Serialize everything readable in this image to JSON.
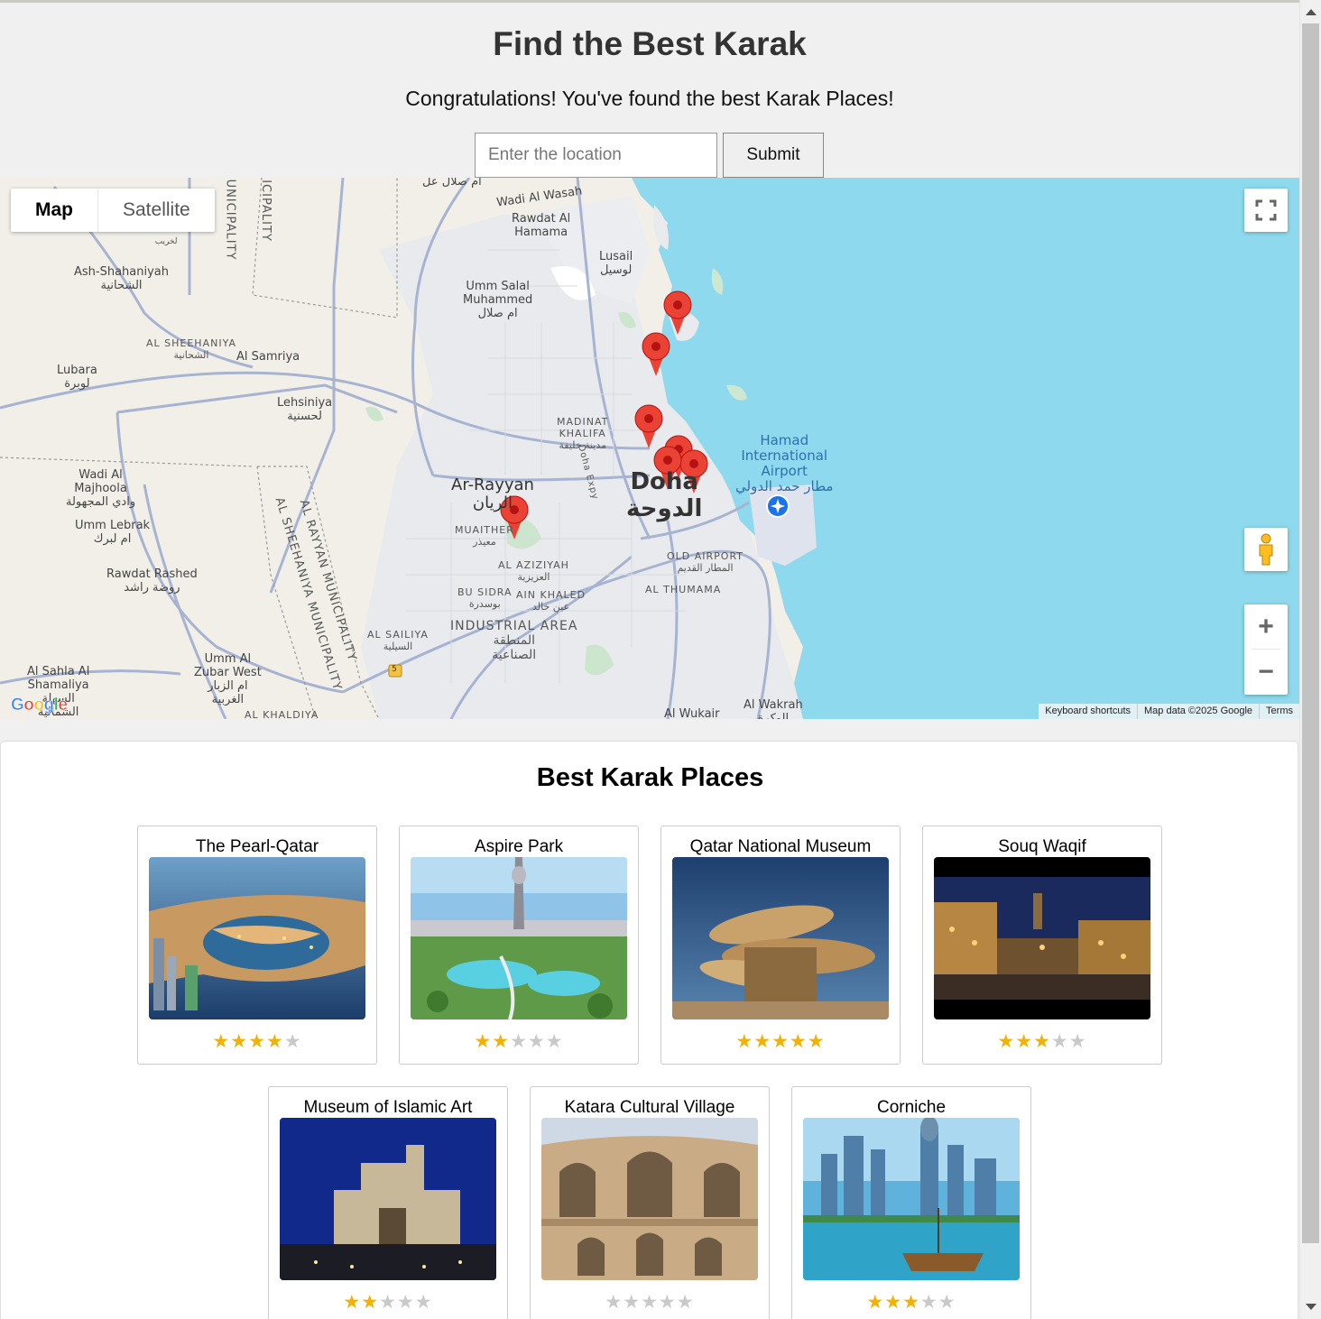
{
  "header": {
    "title": "Find the Best Karak",
    "subtitle": "Congratulations! You've found the best Karak Places!",
    "location_placeholder": "Enter the location",
    "submit_label": "Submit"
  },
  "map": {
    "type_control": {
      "map_label": "Map",
      "satellite_label": "Satellite",
      "selected": "Map"
    },
    "zoom_in": "+",
    "zoom_out": "−",
    "google_logo": "Google",
    "attribution": {
      "keyboard_shortcuts": "Keyboard shortcuts",
      "map_data": "Map data ©2025 Google",
      "terms": "Terms"
    },
    "labels": {
      "dukhan_top": "ام صلال عل",
      "wadi_al_wasah": "Wadi Al Wasah",
      "rawdat_al_hamama": "Rawdat Al\nHamama",
      "lusail": "Lusail\nلوسيل",
      "ash_shahaniyah": "Ash-Shahaniyah\nالشحانية",
      "umm_salal": "Umm Salal\nMuhammed\nام صلال",
      "al_sheehaniya": "AL SHEEHANIYA\nالشحانية",
      "al_samriya": "Al Samriya",
      "lubara": "Lubara\nلوبرة",
      "lehsiniya": "Lehsiniya\nلحسنية",
      "madinat_khalifa": "MADINAT\nKHALIFA\nمدينة خليفة",
      "hamad_airport": "Hamad\nInternational\nAirport\nمطار حمد الدولي",
      "wadi_al_majhoula": "Wadi Al\nMajhoola\nوادي المجهولة",
      "ar_rayyan": "Ar-Rayyan\nالريان",
      "doha": "Doha\nالدوحة",
      "muaither": "MUAITHER\nمعيذر",
      "umm_lebrak": "Umm Lebrak\nام لبرك",
      "doha_expy": "Doha Expy",
      "old_airport": "OLD AIRPORT\nالمطار القديم",
      "al_aziziyah": "AL AZIZIYAH\nالعزيزية",
      "rawdat_rashed": "Rawdat Rashed\nروضة راشد",
      "bu_sidra": "BU SIDRA\nبوسدرة",
      "ain_khaled": "AIN KHALED\nعين خالد",
      "al_thumama": "AL THUMAMA",
      "industrial_area": "INDUSTRIAL AREA\nالمنطقة\nالصناعية",
      "al_sailiya": "AL SAILIYA\nالسيلية",
      "al_rayyan_municipality": "AL RAYYAN MUNICIPALITY",
      "al_sheehaniya_municipality": "AL SHEEHANIYA MUNICIPALITY",
      "municipality_top_a": "UNICIPALITY",
      "municipality_top_b": "ICIPALITY",
      "umm_al_zubar": "Umm Al\nZubar West\nام الزبار\nالغربية",
      "al_sahla": "Al Sahla Al\nShamaliya\nالسهلة\nالشمالية",
      "al_khaldiya": "AL KHALDIYA",
      "al_wakrah": "Al Wakrah\nالوكرة",
      "al_wukair": "Al Wukair",
      "route_5": "5",
      "lekhraib": "LEKHRAIB\nلخريب"
    },
    "markers": [
      "The Pearl-Qatar",
      "Katara Cultural Village",
      "Corniche",
      "Souq Waqif",
      "Qatar National Museum",
      "Museum of Islamic Art",
      "Aspire Park"
    ]
  },
  "places": {
    "heading": "Best Karak Places",
    "items": [
      {
        "name": "The Pearl-Qatar",
        "rating": 4
      },
      {
        "name": "Aspire Park",
        "rating": 2
      },
      {
        "name": "Qatar National Museum",
        "rating": 5
      },
      {
        "name": "Souq Waqif",
        "rating": 3
      },
      {
        "name": "Museum of Islamic Art",
        "rating": 2
      },
      {
        "name": "Katara Cultural Village",
        "rating": 0
      },
      {
        "name": "Corniche",
        "rating": 3
      }
    ]
  },
  "colors": {
    "water": "#8ed9ed",
    "land": "#f1efe8",
    "urban": "#e8eaed",
    "road": "#a6b3d1",
    "marker": "#ea4335",
    "star_on": "#f2b105",
    "star_off": "#c9c9c9"
  }
}
